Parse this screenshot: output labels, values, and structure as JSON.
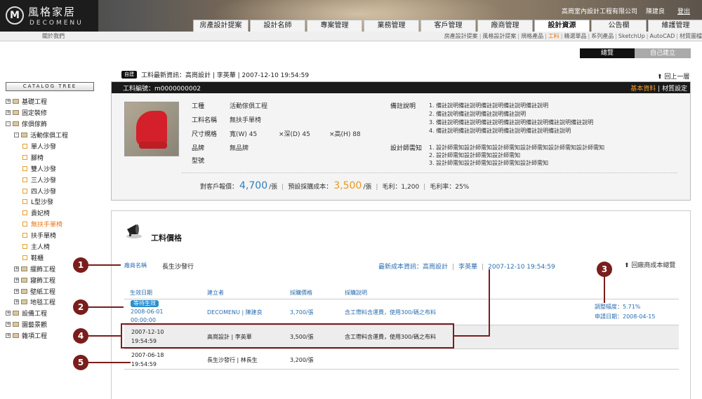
{
  "header": {
    "logo_mark": "M",
    "logo_name": "風格家居",
    "logo_sub": "DECOMENU",
    "company": "高崗室內設計工程有限公司",
    "user": "陳建良",
    "logout": "登出",
    "tabs": [
      "房產設計提案",
      "設計名師",
      "專案管理",
      "業務管理",
      "客戶管理",
      "廠商管理",
      "設計資源",
      "公告欄",
      "維護管理"
    ],
    "active_tab": "設計資源"
  },
  "subnav": {
    "about": "關於我們",
    "items": [
      "房產設計提案",
      "風格設計提案",
      "規格產品",
      "工料",
      "精選單品",
      "系列產品",
      "SketchUp",
      "AutoCAD",
      "材質圖檔"
    ],
    "active": "工料"
  },
  "view_toggle": {
    "all": "總覽",
    "own": "自己建立"
  },
  "sidebar": {
    "title": "CATALOG TREE",
    "items": [
      {
        "label": "基礎工程",
        "level": 0,
        "exp": "+"
      },
      {
        "label": "固定裝修",
        "level": 0,
        "exp": "+"
      },
      {
        "label": "傢俱傢飾",
        "level": 0,
        "exp": "-"
      },
      {
        "label": "活動傢俱工程",
        "level": 1,
        "exp": "-"
      },
      {
        "label": "單人沙發",
        "level": 2
      },
      {
        "label": "腳椅",
        "level": 2
      },
      {
        "label": "雙人沙發",
        "level": 2
      },
      {
        "label": "三人沙發",
        "level": 2
      },
      {
        "label": "四人沙發",
        "level": 2
      },
      {
        "label": "L型沙發",
        "level": 2
      },
      {
        "label": "貴妃椅",
        "level": 2
      },
      {
        "label": "無扶手單椅",
        "level": 2,
        "selected": true
      },
      {
        "label": "扶手單椅",
        "level": 2
      },
      {
        "label": "主人椅",
        "level": 2
      },
      {
        "label": "鞋櫃",
        "level": 2
      },
      {
        "label": "擺飾工程",
        "level": 1,
        "exp": "+"
      },
      {
        "label": "寢飾工程",
        "level": 1,
        "exp": "+"
      },
      {
        "label": "壁紙工程",
        "level": 1,
        "exp": "+"
      },
      {
        "label": "地毯工程",
        "level": 1,
        "exp": "+"
      },
      {
        "label": "設備工程",
        "level": 0,
        "exp": "+"
      },
      {
        "label": "園藝景觀",
        "level": 0,
        "exp": "+"
      },
      {
        "label": "雜項工程",
        "level": 0,
        "exp": "+"
      }
    ]
  },
  "news": {
    "badge": "自建",
    "text": "工料最新資訊：高崗設計 | 李英華 | 2007-12-10 19:54:59",
    "back_top": "回上一層"
  },
  "detail": {
    "material_no": "工料編號：m0000000002",
    "tab_basic": "基本資料",
    "tab_sep": " | ",
    "tab_material": "材質設定",
    "specs": [
      {
        "label": "工種",
        "value": "活動傢俱工程"
      },
      {
        "label": "工料名稱",
        "value": "無扶手單椅"
      },
      {
        "label": "尺寸規格",
        "value": ""
      },
      {
        "label": "品牌",
        "value": "無品牌"
      },
      {
        "label": "型號",
        "value": ""
      }
    ],
    "dims": {
      "w": "寬(W)  45",
      "d": "×深(D) 45",
      "h": "×高(H) 88"
    },
    "notes_label": "備註說明",
    "notes": [
      "1. 備註說明備註說明備註說明備註說明備註說明",
      "2. 備註說明備註說明備註說明備註說明",
      "3. 備註說明備註說明備註說明備註說明備註說明備註說明備註說明",
      "4. 備註說明備註說明備註說明備註說明備註說明備註說明"
    ],
    "designer_label": "設計師需知",
    "designer_notes": [
      "1. 設計師需知設計師需知設計師需知設計師需知設計師需知設計師需知",
      "2. 設計師需知設計師需知設計師需知",
      "3. 設計師需知設計師需知設計師需知設計師需知"
    ],
    "price": {
      "client_label": "對客戶報價：",
      "client_value": "4,700",
      "client_unit": "/張",
      "cost_label": "預設採購成本：",
      "cost_value": "3,500",
      "cost_unit": "/張",
      "profit": "毛利：1,200",
      "margin": "毛利率：25%"
    }
  },
  "pricing": {
    "title": "工料價格",
    "vendor_label": "廠商名稱",
    "vendor_name": "長生沙發行",
    "latest_label": "最新成本資訊：高崗設計",
    "latest_person": "李英華",
    "latest_time": "2007-12-10 19:54:59",
    "return_link": "回廠商成本總覽",
    "headers": [
      "生效日期",
      "建立者",
      "採購價格",
      "採購說明"
    ],
    "rows": [
      {
        "badge": "等待生效",
        "date": "2008-06-01",
        "time": "00:00:00",
        "creator": "DECOMENU | 陳建良",
        "price": "3,700/張",
        "desc": "含工帶料含運費，使用300/碼之布料"
      },
      {
        "date": "2007-12-10",
        "time": "19:54:59",
        "creator": "高崗設計 | 李英華",
        "price": "3,500/張",
        "desc": "含工帶料含運費，使用300/碼之布料"
      },
      {
        "date": "2007-06-18",
        "time": "19:54:59",
        "creator": "長生沙發行 | 林長生",
        "price": "3,200/張",
        "desc": ""
      }
    ],
    "adjust": "調整幅度：5.71%",
    "apply_date": "申請日期：2008-04-15"
  },
  "callouts": [
    "1",
    "2",
    "3",
    "4",
    "5"
  ],
  "colors": {
    "callout": "#7a1d1d",
    "accent_orange": "#e8771a",
    "link_blue": "#2a6db0",
    "price_blue": "#2a7fc0",
    "price_orange": "#e89a1a"
  }
}
